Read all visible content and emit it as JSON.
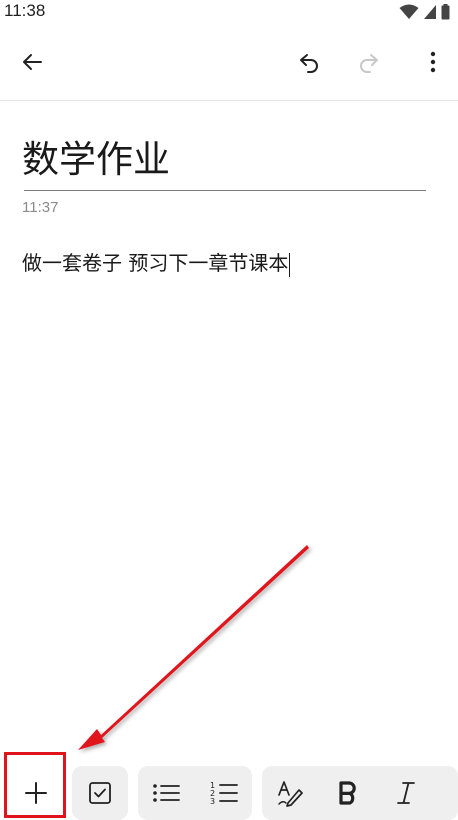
{
  "status_bar": {
    "time": "11:38"
  },
  "app_bar": {
    "back_icon": "arrow-left-icon",
    "undo_icon": "undo-icon",
    "redo_icon": "redo-icon",
    "more_icon": "more-vertical-icon"
  },
  "note": {
    "title": "数学作业",
    "time": "11:37",
    "body": "做一套卷子 预习下一章节课本"
  },
  "toolbar": {
    "items": [
      "plus-icon",
      "checkbox-icon",
      "bullet-list-icon",
      "numbered-list-icon",
      "text-style-icon",
      "bold-icon",
      "italic-icon"
    ]
  },
  "colors": {
    "annotation": "#e0141d",
    "toolbar_bg": "#efefef"
  }
}
